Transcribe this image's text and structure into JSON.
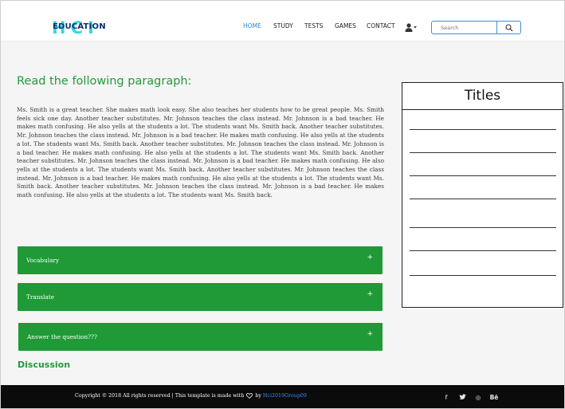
{
  "header": {
    "logo_text": "EDUCATION",
    "logo_letters": "HCI",
    "nav": [
      "HOME",
      "STUDY",
      "TESTS",
      "GAMES",
      "CONTACT"
    ],
    "search_placeholder": "Search"
  },
  "main": {
    "heading": "Read the following paragraph:",
    "paragraph": "Ms. Smith is a great teacher. She makes math look easy. She also teaches her students how to be great people. Ms. Smith feels sick one day. Another teacher substitutes. Mr. Johnson teaches the class instead. Mr. Johnson is a bad teacher. He makes math confusing. He also yells at the students a lot. The students want Ms. Smith back. Another teacher substitutes. Mr. Johnson teaches the class instead. Mr. Johnson is a bad teacher. He makes math confusing. He also yells at the students a lot. The students want Ms. Smith back. Another teacher substitutes. Mr. Johnson teaches the class instead. Mr. Johnson is a bad teacher. He makes math confusing. He also yells at the students a lot. The students want Ms. Smith back. Another teacher substitutes. Mr. Johnson teaches the class instead. Mr. Johnson is a bad teacher. He makes math confusing. He also yells at the students a lot. The students want Ms. Smith back. Another teacher substitutes. Mr. Johnson teaches the class instead. Mr. Johnson is a bad teacher. He makes math confusing. He also yells at the students a lot. The students want Ms. Smith back. Another teacher substitutes. Mr. Johnson teaches the class instead. Mr. Johnson is a bad teacher. He makes math confusing. He also yells at the students a lot. The students want Ms. Smith back.",
    "accordions": [
      {
        "label": "Vocabulary",
        "toggle": "+"
      },
      {
        "label": "Translate",
        "toggle": "+"
      },
      {
        "label": "Answer the question???",
        "toggle": "+"
      }
    ],
    "discussion": "Discussion"
  },
  "titles_panel": {
    "title": "Titles"
  },
  "footer": {
    "copyright": "Copyright © 2018 All rights reserved | This template is made with",
    "by": "by",
    "credit": "Hci2019Group09",
    "social": [
      "f",
      "𝕪",
      "◎",
      "Bē"
    ]
  },
  "colors": {
    "accent_green": "#1f9a36",
    "nav_active": "#2b86d6",
    "footer_bg": "#0b0b0b"
  },
  "icons": [
    "user-icon",
    "search-icon",
    "heart-icon",
    "facebook-icon",
    "twitter-icon",
    "dribbble-icon",
    "behance-icon"
  ]
}
